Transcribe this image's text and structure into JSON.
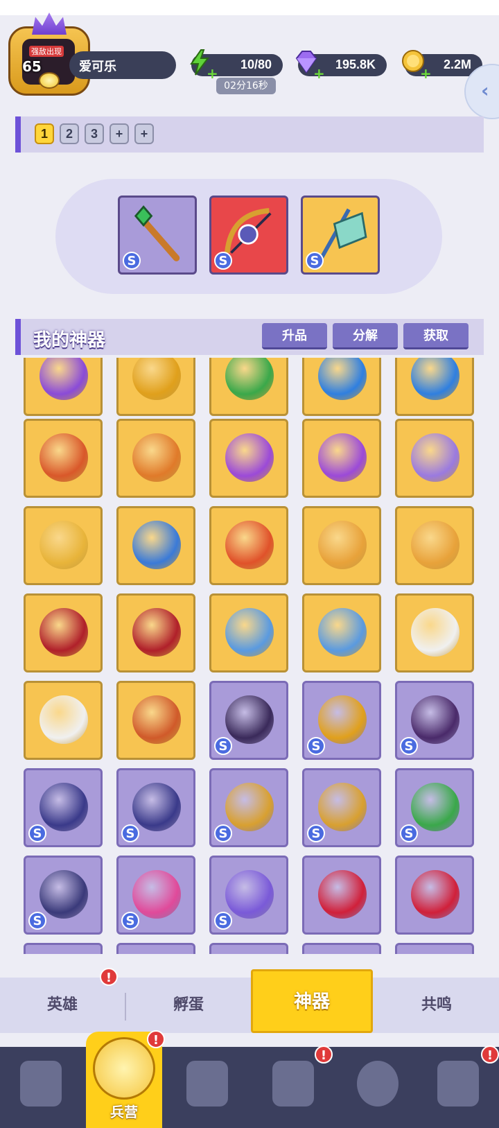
{
  "player": {
    "level": "65",
    "name": "爱可乐",
    "avatar_tag": "强敌出现"
  },
  "resources": {
    "energy": "10/80",
    "energy_timer": "02分16秒",
    "gems": "195.8K",
    "coins": "2.2M"
  },
  "presets": [
    "1",
    "2",
    "3",
    "+",
    "+"
  ],
  "equipped": [
    {
      "icon": "green-gem-staff-icon",
      "rarity": "S",
      "bg": "#a99bd9"
    },
    {
      "icon": "starry-bow-icon",
      "rarity": "S",
      "bg": "#e8474a"
    },
    {
      "icon": "magic-flag-icon",
      "rarity": "S",
      "bg": "#f7c451"
    }
  ],
  "section": {
    "title": "我的神器",
    "buttons": [
      "升品",
      "分解",
      "获取"
    ]
  },
  "grid": [
    {
      "icon": "purple-amulet-icon",
      "rarity": "",
      "bg": "gold",
      "color": "#8a4bd8"
    },
    {
      "icon": "gold-amulet-icon",
      "rarity": "",
      "bg": "gold",
      "color": "#e0a01c"
    },
    {
      "icon": "green-amulet-icon",
      "rarity": "",
      "bg": "gold",
      "color": "#3aa84a"
    },
    {
      "icon": "blue-amulet-icon",
      "rarity": "",
      "bg": "gold",
      "color": "#2f7fe0"
    },
    {
      "icon": "blue-amulet-icon",
      "rarity": "",
      "bg": "gold",
      "color": "#2f7fe0"
    },
    {
      "icon": "maple-leaf-icon",
      "rarity": "",
      "bg": "gold",
      "color": "#d9582a"
    },
    {
      "icon": "bell-icon",
      "rarity": "",
      "bg": "gold",
      "color": "#e07a2a"
    },
    {
      "icon": "purple-potion-icon",
      "rarity": "",
      "bg": "gold",
      "color": "#9b4ad8"
    },
    {
      "icon": "purple-potion-icon",
      "rarity": "",
      "bg": "gold",
      "color": "#9b4ad8"
    },
    {
      "icon": "purple-fluff-icon",
      "rarity": "",
      "bg": "gold",
      "color": "#9a7ae0"
    },
    {
      "icon": "yellow-potion-icon",
      "rarity": "",
      "bg": "gold",
      "color": "#e8b43a"
    },
    {
      "icon": "blue-flame-torch-icon",
      "rarity": "",
      "bg": "gold",
      "color": "#3a7ad8"
    },
    {
      "icon": "red-flame-torch-icon",
      "rarity": "",
      "bg": "gold",
      "color": "#e0522a"
    },
    {
      "icon": "scroll-icon",
      "rarity": "",
      "bg": "gold",
      "color": "#e8a23a"
    },
    {
      "icon": "scroll-icon",
      "rarity": "",
      "bg": "gold",
      "color": "#e8a23a"
    },
    {
      "icon": "red-helmet-icon",
      "rarity": "",
      "bg": "gold",
      "color": "#b0202a"
    },
    {
      "icon": "red-helmet-icon",
      "rarity": "",
      "bg": "gold",
      "color": "#b0202a"
    },
    {
      "icon": "stopwatch-icon",
      "rarity": "",
      "bg": "gold",
      "color": "#5a9ae0"
    },
    {
      "icon": "stopwatch-icon",
      "rarity": "",
      "bg": "gold",
      "color": "#5a9ae0"
    },
    {
      "icon": "dice-icon",
      "rarity": "",
      "bg": "gold",
      "color": "#f0f0f0"
    },
    {
      "icon": "dice-icon",
      "rarity": "",
      "bg": "gold",
      "color": "#f0f0f0"
    },
    {
      "icon": "drum-icon",
      "rarity": "",
      "bg": "gold",
      "color": "#d05a2a"
    },
    {
      "icon": "dark-dagger-icon",
      "rarity": "S",
      "bg": "purple",
      "color": "#3a2a5a"
    },
    {
      "icon": "gold-ring-icon",
      "rarity": "S",
      "bg": "purple",
      "color": "#e0a01c"
    },
    {
      "icon": "dark-armor-icon",
      "rarity": "S",
      "bg": "purple",
      "color": "#4a2a6a"
    },
    {
      "icon": "dark-wing-icon",
      "rarity": "S",
      "bg": "purple",
      "color": "#3a3a8a"
    },
    {
      "icon": "dark-wing-icon",
      "rarity": "S",
      "bg": "purple",
      "color": "#3a3a8a"
    },
    {
      "icon": "gold-crossbow-icon",
      "rarity": "S",
      "bg": "purple",
      "color": "#d8a030"
    },
    {
      "icon": "gold-crossbow-icon",
      "rarity": "S",
      "bg": "purple",
      "color": "#d8a030"
    },
    {
      "icon": "green-gem-staff-icon",
      "rarity": "S",
      "bg": "purple",
      "color": "#3aa84a"
    },
    {
      "icon": "starry-bow-icon",
      "rarity": "S",
      "bg": "purple",
      "color": "#3a3a7a"
    },
    {
      "icon": "pink-potion-icon",
      "rarity": "S",
      "bg": "purple",
      "color": "#e04a9a"
    },
    {
      "icon": "orb-scepter-icon",
      "rarity": "S",
      "bg": "purple",
      "color": "#7a5ad8"
    },
    {
      "icon": "heart-crown-icon",
      "rarity": "",
      "bg": "purple",
      "color": "#d0203a"
    },
    {
      "icon": "heart-crown-icon",
      "rarity": "",
      "bg": "purple",
      "color": "#d0203a"
    }
  ],
  "subtabs": [
    "英雄",
    "孵蛋",
    "神器",
    "共鸣"
  ],
  "nav": {
    "active_label": "兵营",
    "items": [
      "cards-icon",
      "barracks-icon",
      "map-book-icon",
      "castle-icon",
      "mushroom-icon",
      "shield-banner-icon"
    ]
  },
  "colors": {
    "accent": "#6d52d8",
    "gold_tile": "#f7c451",
    "purple_tile": "#a99bd9",
    "active_tab": "#ffcf1a"
  }
}
